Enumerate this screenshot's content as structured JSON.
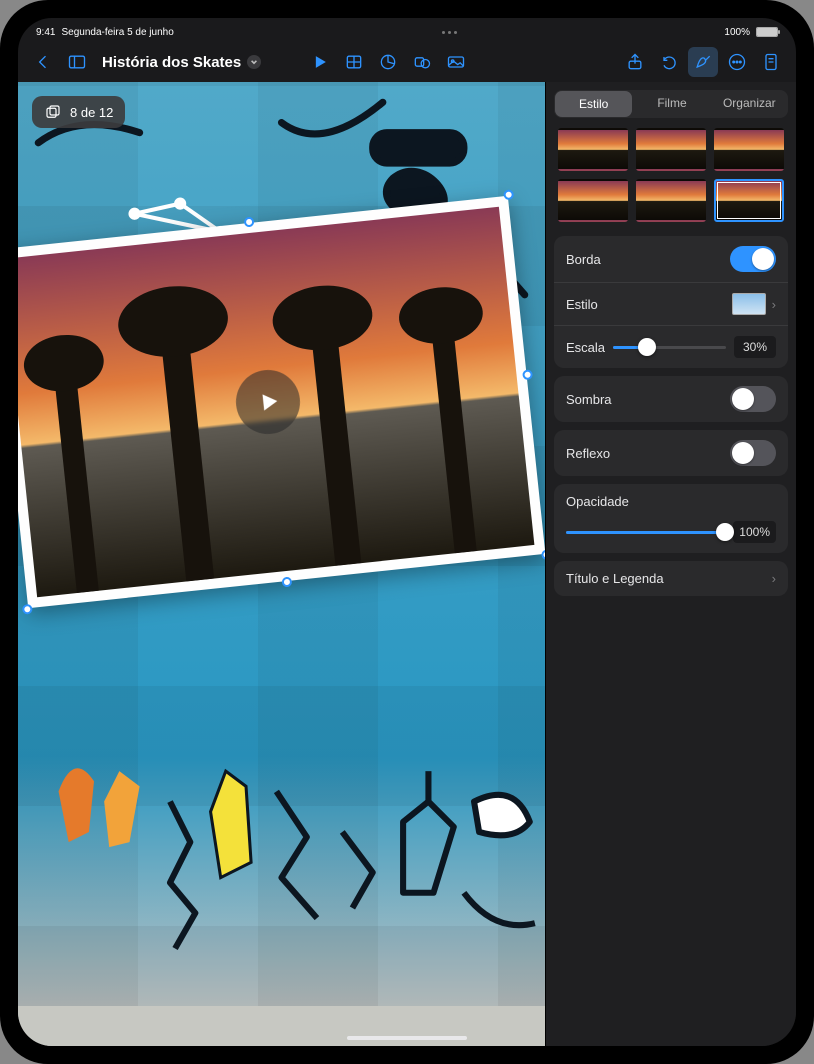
{
  "status": {
    "time": "9:41",
    "date": "Segunda-feira 5 de junho",
    "battery": "100%"
  },
  "toolbar": {
    "doc_title": "História dos Skates"
  },
  "canvas": {
    "slide_indicator": "8 de 12"
  },
  "inspector": {
    "tabs": {
      "style": "Estilo",
      "movie": "Filme",
      "arrange": "Organizar"
    },
    "border": {
      "label": "Borda",
      "on": true
    },
    "borderStyle": {
      "label": "Estilo"
    },
    "scale": {
      "label": "Escala",
      "value": "30%",
      "pct": 30
    },
    "shadow": {
      "label": "Sombra",
      "on": false
    },
    "reflection": {
      "label": "Reflexo",
      "on": false
    },
    "opacity": {
      "label": "Opacidade",
      "value": "100%",
      "pct": 100
    },
    "caption": {
      "label": "Título e Legenda"
    }
  }
}
